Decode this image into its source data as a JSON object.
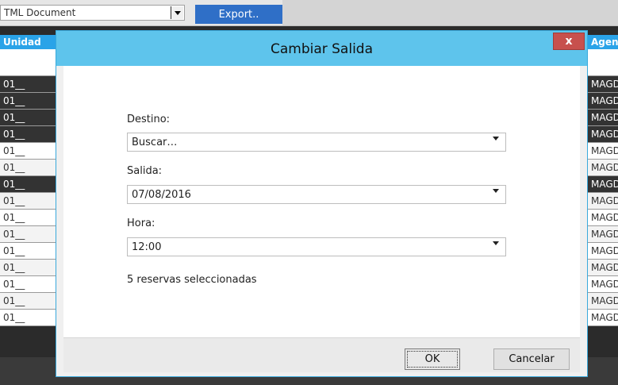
{
  "toolbar": {
    "format_value": "TML Document",
    "export_label": "Export.."
  },
  "grid": {
    "col_unidad": "Unidad",
    "col_agencia": "Agenc",
    "rows": [
      {
        "unidad": "01__",
        "agencia": "MAGD",
        "style": "dark"
      },
      {
        "unidad": "01__",
        "agencia": "MAGD",
        "style": "dark"
      },
      {
        "unidad": "01__",
        "agencia": "MAGD",
        "style": "dark"
      },
      {
        "unidad": "01__",
        "agencia": "MAGD",
        "style": "dark"
      },
      {
        "unidad": "01__",
        "agencia": "MAGD",
        "style": "light"
      },
      {
        "unidad": "01__",
        "agencia": "MAGD",
        "style": "alt"
      },
      {
        "unidad": "01__",
        "agencia": "MAGD",
        "style": "dark"
      },
      {
        "unidad": "01__",
        "agencia": "MAGD",
        "style": "alt"
      },
      {
        "unidad": "01__",
        "agencia": "MAGD",
        "style": "light"
      },
      {
        "unidad": "01__",
        "agencia": "MAGD",
        "style": "alt"
      },
      {
        "unidad": "01__",
        "agencia": "MAGD",
        "style": "light"
      },
      {
        "unidad": "01__",
        "agencia": "MAGD",
        "style": "alt"
      },
      {
        "unidad": "01__",
        "agencia": "MAGD",
        "style": "light"
      },
      {
        "unidad": "01__",
        "agencia": "MAGD",
        "style": "alt"
      },
      {
        "unidad": "01__",
        "agencia": "MAGD",
        "style": "light"
      }
    ]
  },
  "dialog": {
    "title": "Cambiar Salida",
    "close_label": "x",
    "destino_label": "Destino:",
    "destino_value": "Buscar…",
    "salida_label": "Salida:",
    "salida_value": "07/08/2016",
    "hora_label": "Hora:",
    "hora_value": "12:00",
    "selection_count": "5 reservas seleccionadas",
    "ok_label": "OK",
    "cancel_label": "Cancelar"
  },
  "colors": {
    "title_bar": "#5ec4ec",
    "grid_header": "#2aa3e8",
    "export_button": "#2f6fc7",
    "close_button": "#c7504d"
  }
}
